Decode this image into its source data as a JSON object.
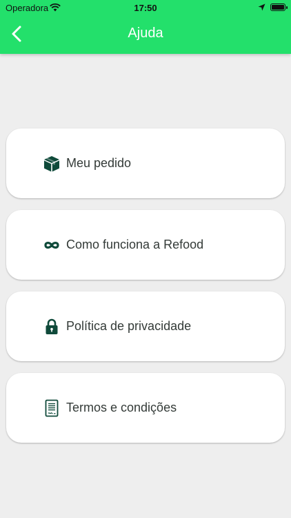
{
  "status_bar": {
    "carrier": "Operadora",
    "time": "17:50"
  },
  "header": {
    "title": "Ajuda",
    "background": "#23e06b"
  },
  "menu": {
    "items": [
      {
        "label": "Meu pedido",
        "icon": "package-icon"
      },
      {
        "label": "Como funciona a Refood",
        "icon": "infinity-icon"
      },
      {
        "label": "Política de privacidade",
        "icon": "lock-icon"
      },
      {
        "label": "Termos e condições",
        "icon": "document-icon"
      }
    ]
  },
  "colors": {
    "icon": "#0f4a3a",
    "text": "#333a37",
    "page_background": "#eeeeee"
  }
}
